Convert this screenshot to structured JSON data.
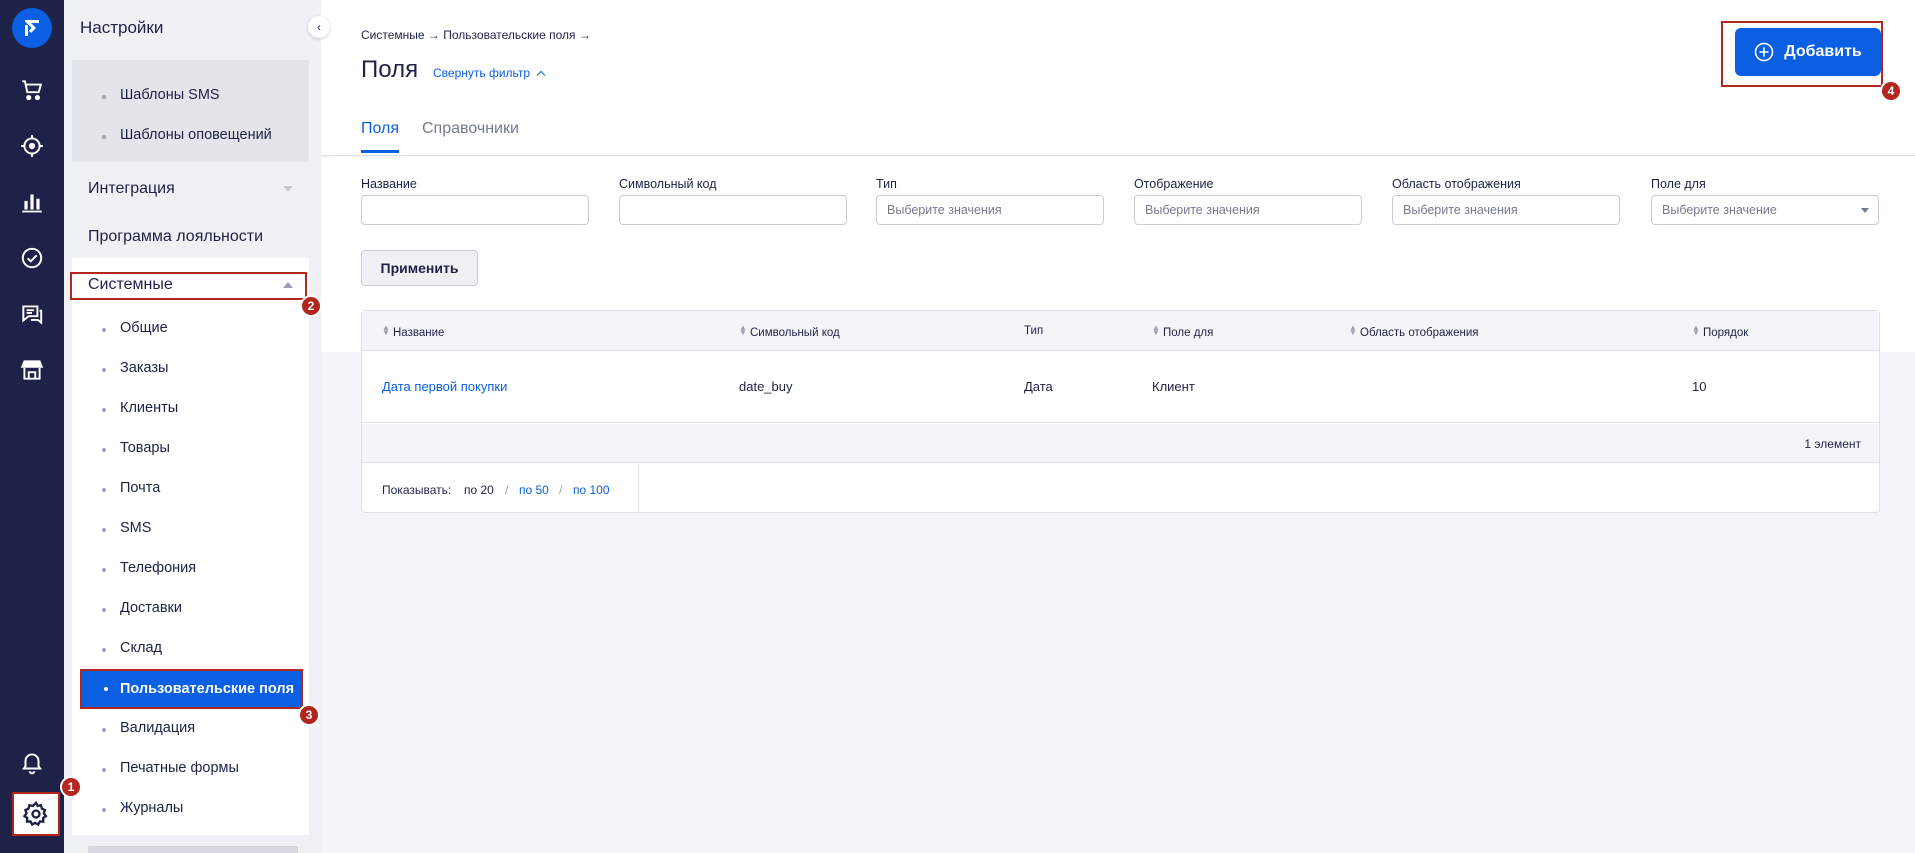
{
  "rail": {
    "logo_icon": "retailcrm-logo-icon",
    "items": [
      {
        "name": "cart-icon"
      },
      {
        "name": "target-icon"
      },
      {
        "name": "analytics-icon"
      },
      {
        "name": "tasks-icon"
      },
      {
        "name": "chat-icon"
      },
      {
        "name": "store-icon"
      },
      {
        "name": "bell-icon"
      },
      {
        "name": "gear-icon"
      }
    ]
  },
  "sidebar": {
    "title": "Настройки",
    "templates": [
      "Шаблоны SMS",
      "Шаблоны оповещений"
    ],
    "groups": {
      "integration": "Интеграция",
      "loyalty": "Программа лояльности",
      "system": "Системные"
    },
    "system_items": [
      "Общие",
      "Заказы",
      "Клиенты",
      "Товары",
      "Почта",
      "SMS",
      "Телефония",
      "Доставки",
      "Склад",
      "Пользовательские поля",
      "Валидация",
      "Печатные формы",
      "Журналы"
    ],
    "active_item": "Пользовательские поля",
    "collapse_glyph": "‹"
  },
  "badges": [
    "1",
    "2",
    "3",
    "4"
  ],
  "header": {
    "breadcrumb": "Системные → Пользовательские поля →",
    "title": "Поля",
    "filter_toggle": "Свернуть фильтр",
    "tabs": [
      "Поля",
      "Справочники"
    ],
    "add_button": "Добавить"
  },
  "filters": {
    "name_label": "Название",
    "code_label": "Символьный код",
    "type_label": "Тип",
    "type_placeholder": "Выберите значения",
    "display_label": "Отображение",
    "display_placeholder": "Выберите значения",
    "area_label": "Область отображения",
    "area_placeholder": "Выберите значения",
    "entity_label": "Поле для",
    "entity_placeholder": "Выберите значение",
    "apply": "Применить"
  },
  "table": {
    "columns": [
      "Название",
      "Символьный код",
      "Тип",
      "Поле для",
      "Область отображения",
      "Порядок"
    ],
    "rows": [
      {
        "name": "Дата первой покупки",
        "code": "date_buy",
        "type": "Дата",
        "entity": "Клиент",
        "area": "",
        "order": "10"
      }
    ],
    "count": "1 элемент",
    "pager_label": "Показывать:",
    "pager_current": "по 20",
    "pager_50": "по 50",
    "pager_100": "по 100",
    "pager_sep": "/"
  },
  "colors": {
    "rail": "#1e2248",
    "accent": "#0a5fe3",
    "highlight": "#b3261e"
  }
}
